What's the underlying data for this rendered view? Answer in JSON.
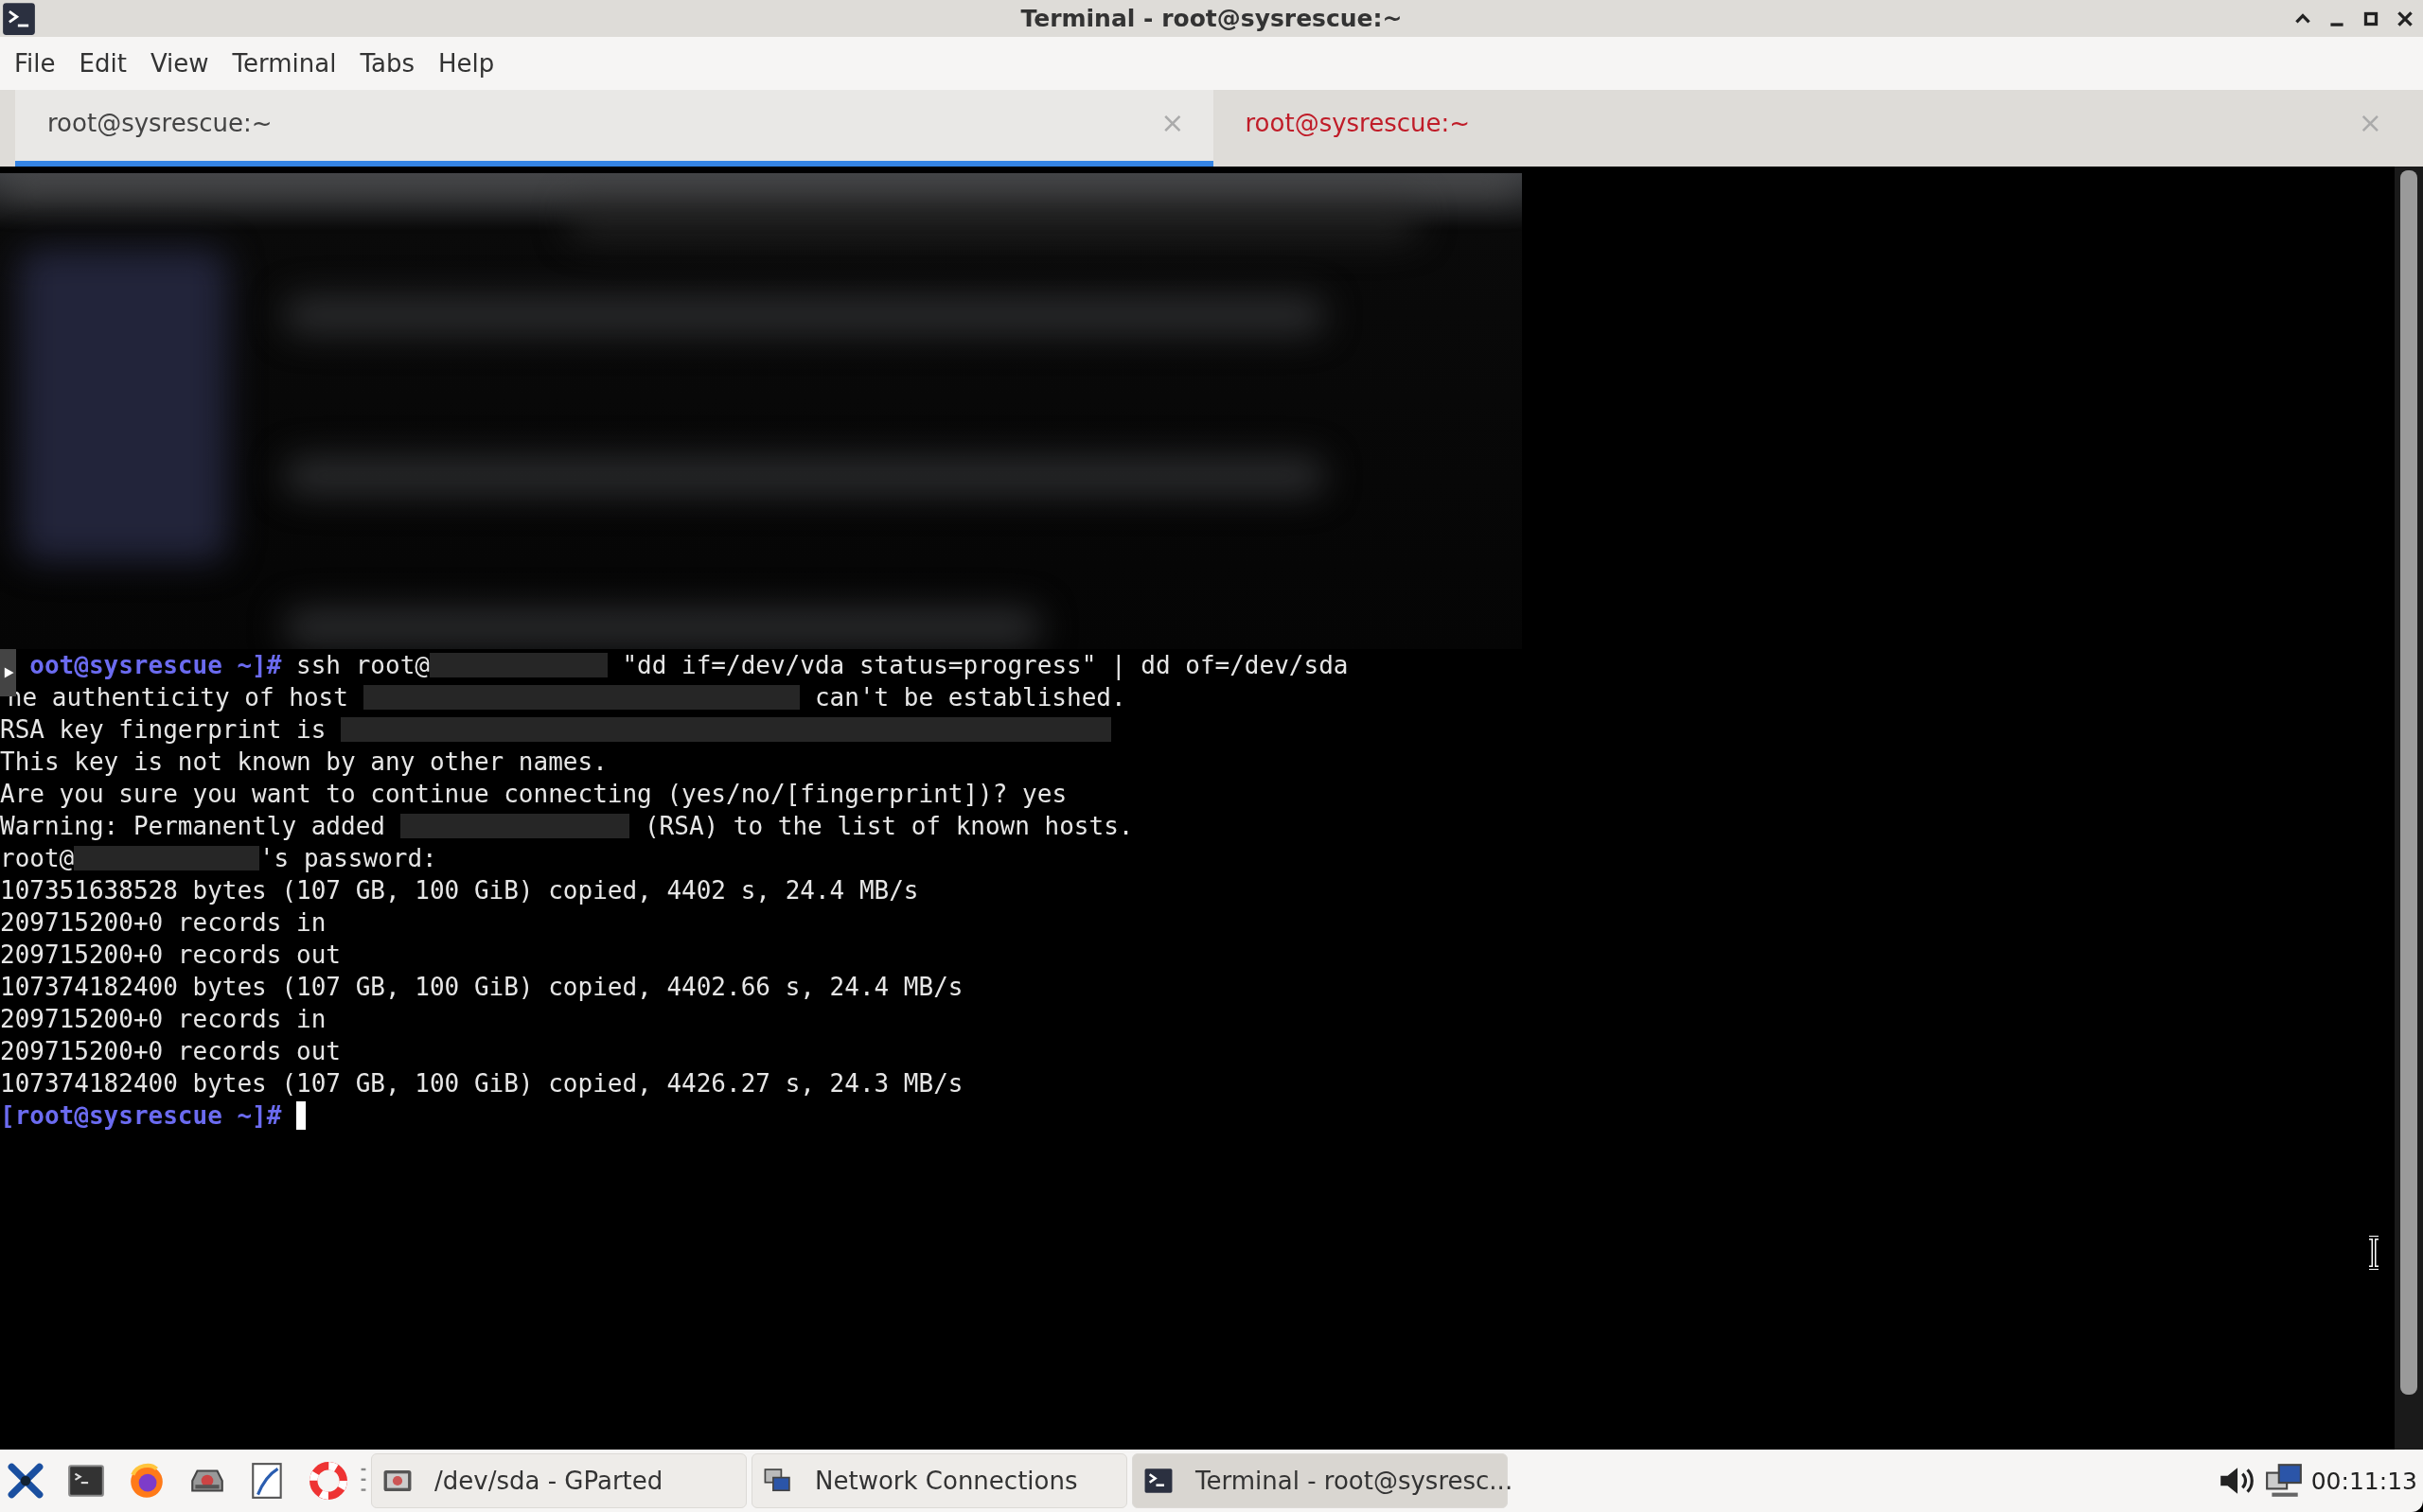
{
  "window": {
    "title": "Terminal - root@sysrescue:~"
  },
  "menu": [
    "File",
    "Edit",
    "View",
    "Terminal",
    "Tabs",
    "Help"
  ],
  "tabs": [
    {
      "label": "root@sysrescue:~",
      "selected": true,
      "activity": false,
      "close": "×"
    },
    {
      "label": "root@sysrescue:~",
      "selected": false,
      "activity": true,
      "close": "×"
    }
  ],
  "terminal": {
    "lines": [
      {
        "segments": [
          {
            "kind": "prompt",
            "text": "oot@sysrescue ~]#"
          },
          {
            "kind": "text",
            "text": " ssh root@"
          },
          {
            "kind": "redacted"
          },
          {
            "kind": "text",
            "text": " \"dd if=/dev/vda status=progress\" | dd of=/dev/sda"
          }
        ]
      },
      {
        "segments": [
          {
            "kind": "text",
            "text": "he authenticity of host "
          },
          {
            "kind": "redacted"
          },
          {
            "kind": "text",
            "text": " can't be established."
          }
        ]
      },
      {
        "segments": [
          {
            "kind": "text",
            "text": "RSA key fingerprint is "
          },
          {
            "kind": "redacted"
          }
        ]
      },
      {
        "segments": [
          {
            "kind": "text",
            "text": "This key is not known by any other names."
          }
        ]
      },
      {
        "segments": [
          {
            "kind": "text",
            "text": "Are you sure you want to continue connecting (yes/no/[fingerprint])? yes"
          }
        ]
      },
      {
        "segments": [
          {
            "kind": "text",
            "text": "Warning: Permanently added "
          },
          {
            "kind": "redacted"
          },
          {
            "kind": "text",
            "text": " (RSA) to the list of known hosts."
          }
        ]
      },
      {
        "segments": [
          {
            "kind": "text",
            "text": "root@"
          },
          {
            "kind": "redacted"
          },
          {
            "kind": "text",
            "text": "'s password:"
          }
        ]
      },
      {
        "segments": [
          {
            "kind": "text",
            "text": "107351638528 bytes (107 GB, 100 GiB) copied, 4402 s, 24.4 MB/s"
          }
        ]
      },
      {
        "segments": [
          {
            "kind": "text",
            "text": "209715200+0 records in"
          }
        ]
      },
      {
        "segments": [
          {
            "kind": "text",
            "text": "209715200+0 records out"
          }
        ]
      },
      {
        "segments": [
          {
            "kind": "text",
            "text": "107374182400 bytes (107 GB, 100 GiB) copied, 4402.66 s, 24.4 MB/s"
          }
        ]
      },
      {
        "segments": [
          {
            "kind": "text",
            "text": "209715200+0 records in"
          }
        ]
      },
      {
        "segments": [
          {
            "kind": "text",
            "text": "209715200+0 records out"
          }
        ]
      },
      {
        "segments": [
          {
            "kind": "text",
            "text": "107374182400 bytes (107 GB, 100 GiB) copied, 4426.27 s, 24.3 MB/s"
          }
        ]
      },
      {
        "segments": [
          {
            "kind": "prompt",
            "text": "[root@sysrescue ~]#"
          },
          {
            "kind": "cursor"
          }
        ]
      }
    ]
  },
  "taskbar": {
    "windows": [
      {
        "label": "/dev/sda - GParted",
        "kind": "disk",
        "selected": false
      },
      {
        "label": "Network Connections",
        "kind": "network",
        "selected": false
      },
      {
        "label": "Terminal - root@sysresc...",
        "kind": "terminal",
        "selected": true
      }
    ],
    "clock": "00:11:13"
  }
}
